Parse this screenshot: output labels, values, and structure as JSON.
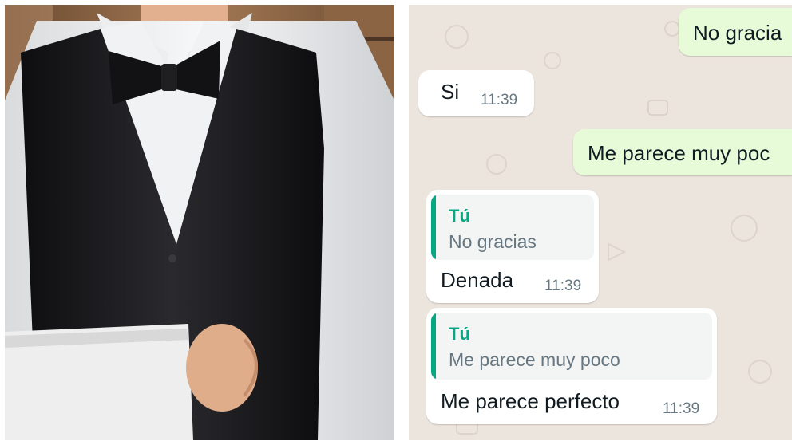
{
  "photo": {
    "subject": "waiter in white shirt, black vest and bow tie holding a white towel"
  },
  "chat": {
    "messages": [
      {
        "direction": "outgoing",
        "text": "No gracia"
      },
      {
        "direction": "incoming",
        "text": "Si",
        "time": "11:39"
      },
      {
        "direction": "outgoing",
        "text": "Me parece muy poc"
      },
      {
        "direction": "incoming",
        "reply_to": {
          "author": "Tú",
          "text": "No gracias"
        },
        "text": "Denada",
        "time": "11:39"
      },
      {
        "direction": "incoming",
        "reply_to": {
          "author": "Tú",
          "text": "Me parece muy poco"
        },
        "text": "Me parece perfecto",
        "time": "11:39"
      }
    ]
  },
  "colors": {
    "chat_background": "#ece5dd",
    "outgoing_bubble": "#e7fbd8",
    "incoming_bubble": "#ffffff",
    "reply_accent": "#06a884",
    "timestamp": "#667781"
  }
}
